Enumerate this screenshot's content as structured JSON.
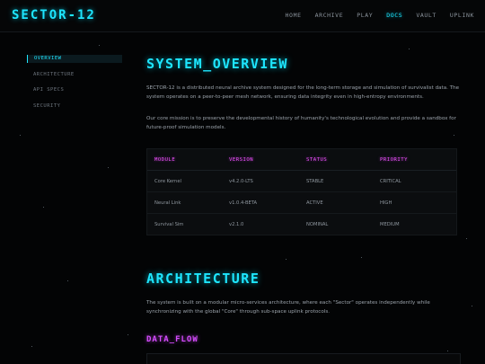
{
  "brand": {
    "logo": "SECTOR-12"
  },
  "nav": {
    "items": [
      "HOME",
      "ARCHIVE",
      "PLAY",
      "DOCS",
      "VAULT",
      "UPLINK"
    ],
    "active": "DOCS"
  },
  "sidebar": {
    "items": [
      "OVERVIEW",
      "ARCHITECTURE",
      "API SPECS",
      "SECURITY"
    ],
    "active": "OVERVIEW"
  },
  "overview": {
    "title": "SYSTEM_OVERVIEW",
    "p1": "SECTOR-12 is a distributed neural archive system designed for the long-term storage and simulation of survivalist data. The system operates on a peer-to-peer mesh network, ensuring data integrity even in high-entropy environments.",
    "p2": "Our core mission is to preserve the developmental history of humanity's technological evolution and provide a sandbox for future-proof simulation models."
  },
  "table": {
    "headers": [
      "MODULE",
      "VERSION",
      "STATUS",
      "PRIORITY"
    ],
    "rows": [
      [
        "Core Kernel",
        "v4.2.0-LTS",
        "STABLE",
        "CRITICAL"
      ],
      [
        "Neural Link",
        "v1.0.4-BETA",
        "ACTIVE",
        "HIGH"
      ],
      [
        "Survival Sim",
        "v2.1.0",
        "NOMINAL",
        "MEDIUM"
      ]
    ]
  },
  "architecture": {
    "title": "ARCHITECTURE",
    "p1": "The system is built on a modular micro-services architecture, where each \"Sector\" operates independently while synchronizing with the global \"Core\" through sub-space uplink protocols.",
    "subtitle": "DATA_FLOW"
  },
  "colors": {
    "accent": "#1ee6ff",
    "secondary": "#f050ff",
    "background": "#030405"
  }
}
